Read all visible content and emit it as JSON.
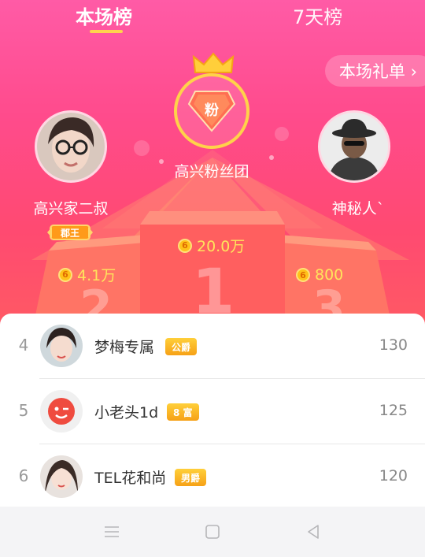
{
  "tabs": {
    "active": "本场榜",
    "inactive": "7天榜"
  },
  "gift_list_button": "本场礼单 ›",
  "fans_group": {
    "badge": "粉",
    "name": "高兴粉丝团"
  },
  "podium": {
    "first": {
      "rank_mark": "1",
      "score": "20.0万",
      "coin": "6"
    },
    "second": {
      "name": "高兴家二叔",
      "title": "郡王",
      "rank_mark": "2",
      "score": "4.1万",
      "coin": "6"
    },
    "third": {
      "name": "神秘人`",
      "rank_mark": "3",
      "score": "800",
      "coin": "6"
    }
  },
  "list": [
    {
      "rank": "4",
      "name": "梦梅专属",
      "badge": "公爵",
      "score": "130"
    },
    {
      "rank": "5",
      "name": "小老头1d",
      "badge": "8 富",
      "score": "125"
    },
    {
      "rank": "6",
      "name": "TEL花和尚",
      "badge": "男爵",
      "score": "120"
    }
  ],
  "colors": {
    "hero_pink": "#ff4b8c",
    "gold": "#ffd24a",
    "score_yellow": "#ffe45c"
  },
  "icons": {
    "crown": "crown-icon",
    "coin": "coin-icon",
    "nav_menu": "menu-icon",
    "nav_home": "home-icon",
    "nav_back": "back-icon"
  }
}
